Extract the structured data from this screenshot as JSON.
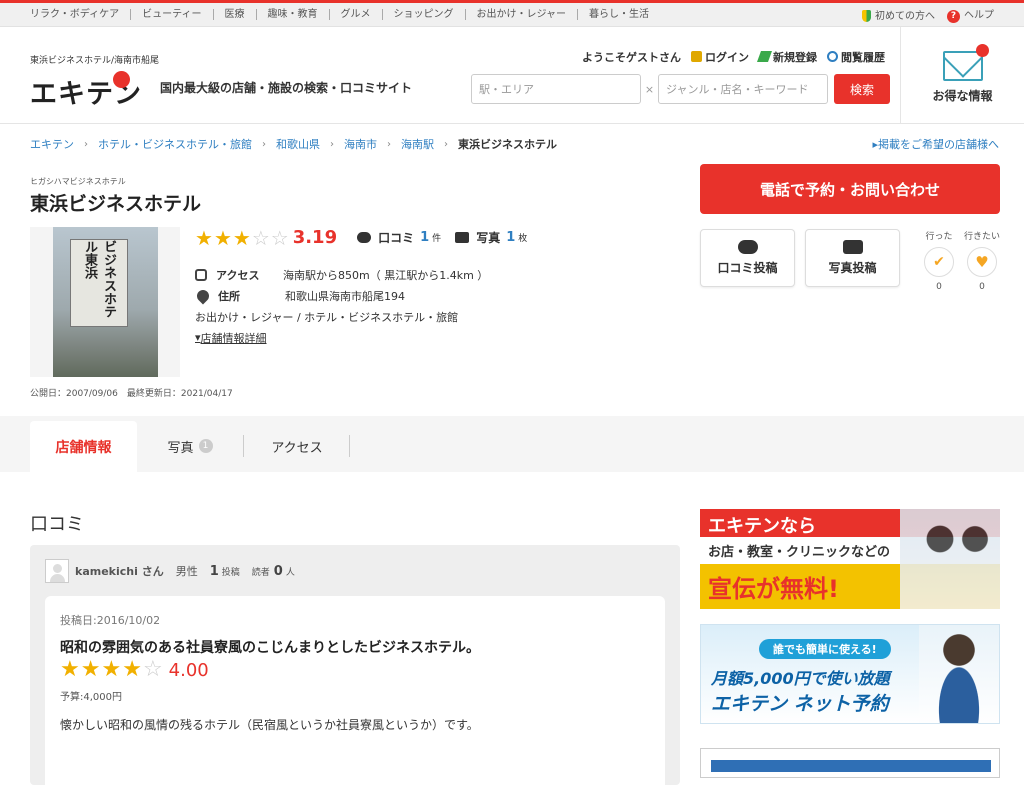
{
  "topbar": {
    "categories": [
      "リラク・ボディケア",
      "ビューティー",
      "医療",
      "趣味・教育",
      "グルメ",
      "ショッピング",
      "お出かけ・レジャー",
      "暮らし・生活"
    ],
    "first_time": "初めての方へ",
    "help": "ヘルプ"
  },
  "header": {
    "site_sub": "東浜ビジネスホテル/海南市船尾",
    "logo": "エキテン",
    "tagline": "国内最大級の店舗・施設の検索・口コミサイト",
    "welcome": "ようこそゲストさん",
    "login": "ログイン",
    "register": "新規登録",
    "history": "閲覧履歴",
    "station_placeholder": "駅・エリア",
    "x_mark": "×",
    "genre_placeholder": "ジャンル・店名・キーワード",
    "search_button": "検索",
    "deals": "お得な情報"
  },
  "breadcrumb": {
    "items": [
      "エキテン",
      "ホテル・ビジネスホテル・旅館",
      "和歌山県",
      "海南市",
      "海南駅"
    ],
    "current": "東浜ビジネスホテル",
    "listing_link": "掲載をご希望の店舗様へ"
  },
  "shop": {
    "kana": "ヒガシハマビジネスホテル",
    "name": "東浜ビジネスホテル",
    "sign_text": "ビジネスホテル東浜",
    "rating": 3.19,
    "rating_text": "3.19",
    "reviews_label": "口コミ",
    "reviews_count": "1",
    "reviews_unit": "件",
    "photos_label": "写真",
    "photos_count": "1",
    "photos_unit": "枚",
    "access_label": "アクセス",
    "access_value": "海南駅から850m（ 黒江駅から1.4km ）",
    "address_label": "住所",
    "address_value": "和歌山県海南市船尾194",
    "categories_line": "お出かけ・レジャー /  ホテル・ビジネスホテル・旅館",
    "detail_link": "店舗情報詳細",
    "dates": "公開日：2007/09/06　最終更新日：2021/04/17"
  },
  "actions": {
    "call": "電話で予約・お問い合わせ",
    "post_review": "口コミ投稿",
    "post_photo": "写真投稿",
    "went_label": "行った",
    "went_count": "0",
    "want_label": "行きたい",
    "want_count": "0"
  },
  "tabs": {
    "info": "店舗情報",
    "photos": "写真",
    "photos_badge": "1",
    "access": "アクセス"
  },
  "reviews": {
    "section_title": "口コミ",
    "reviewer_name": "kamekichi さん",
    "gender": "男性",
    "post_count": "1",
    "post_unit": "投稿",
    "readers_label": "読者",
    "readers_count": "0",
    "readers_unit": "人",
    "posted_date": "投稿日:2016/10/02",
    "title": "昭和の雰囲気のある社員寮風のこじんまりとしたビジネスホテル。",
    "score": 4.0,
    "score_text": "4.00",
    "budget": "予算:4,000円",
    "body": "懐かしい昭和の風情の残るホテル（民宿風というか社員寮風というか）です。"
  },
  "ads": {
    "ad1_line1": "エキテンなら",
    "ad1_line2": "お店・教室・クリニックなどの",
    "ad1_line3": "宣伝が無料!",
    "ad2_pill": "誰でも簡単に使える!",
    "ad2_line2": "月額5,000円で使い放題",
    "ad2_line3": "エキテン ネット予約"
  },
  "colors": {
    "brand_red": "#e8322b",
    "link_blue": "#2f7fc1",
    "star_gold": "#f1b000"
  }
}
